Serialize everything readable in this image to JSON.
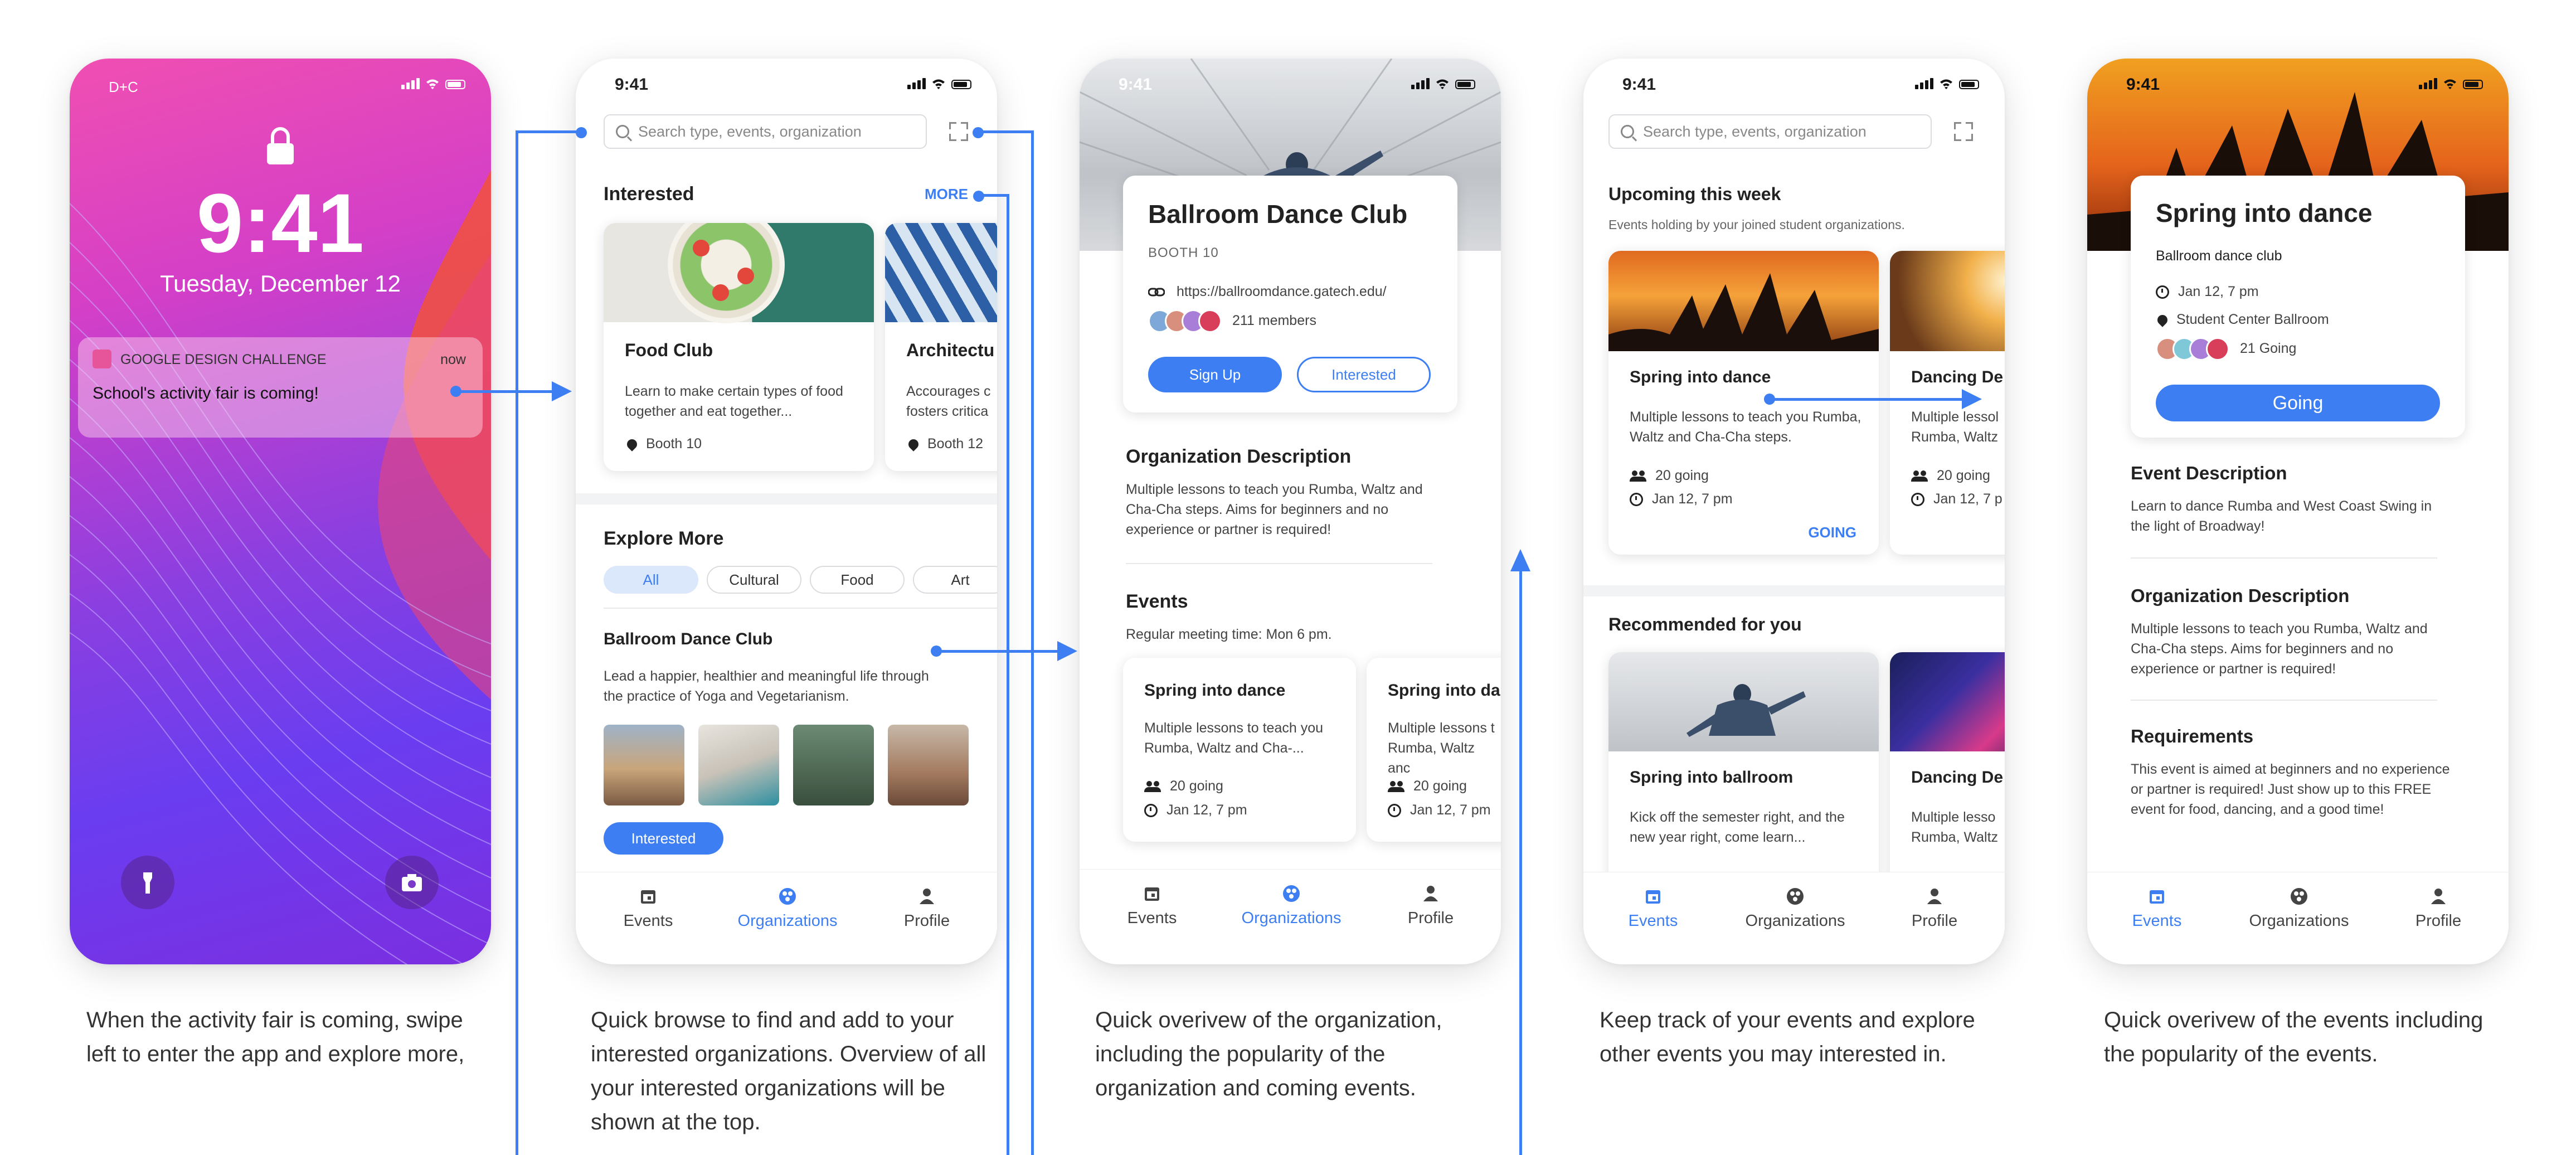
{
  "colors": {
    "accent": "#3d7ff2"
  },
  "phone1": {
    "carrier": "D+C",
    "time": "9:41",
    "date": "Tuesday, December 12",
    "notification": {
      "app": "GOOGLE DESIGN CHALLENGE",
      "when": "now",
      "message": "School's activity fair is coming!"
    },
    "icons": [
      "lock-icon",
      "flashlight-icon",
      "camera-icon"
    ]
  },
  "phone2": {
    "time": "9:41",
    "search_placeholder": "Search type, events, organization",
    "interested_title": "Interested",
    "more_label": "MORE",
    "cards": [
      {
        "title": "Food Club",
        "desc": "Learn to make certain types of food together and eat together...",
        "booth": "Booth 10"
      },
      {
        "title": "Architectu",
        "desc": "Accourages c fosters critica",
        "booth": "Booth 12"
      }
    ],
    "explore_title": "Explore More",
    "chips": [
      "All",
      "Cultural",
      "Food",
      "Art"
    ],
    "club_title": "Ballroom Dance Club",
    "club_desc": "Lead a happier, healthier and meaningful life through the practice of Yoga and Vegetarianism.",
    "interested_btn": "Interested",
    "nav": [
      "Events",
      "Organizations",
      "Profile"
    ]
  },
  "phone3": {
    "time": "9:41",
    "title": "Ballroom Dance Club",
    "booth": "BOOTH 10",
    "url": "https://ballroomdance.gatech.edu/",
    "members": "211 members",
    "signup": "Sign Up",
    "interested": "Interested",
    "org_title": "Organization Description",
    "org_desc": "Multiple lessons to teach you Rumba, Waltz and Cha-Cha steps. Aims for beginners and no experience or partner is required!",
    "events_title": "Events",
    "meeting": "Regular meeting time: Mon 6 pm.",
    "events": [
      {
        "title": "Spring into dance",
        "desc": "Multiple lessons to teach you Rumba, Waltz and Cha-...",
        "going": "20 going",
        "date": "Jan 12, 7 pm"
      },
      {
        "title": "Spring into da",
        "desc": "Multiple lessons t Rumba, Waltz anc",
        "going": "20 going",
        "date": "Jan 12, 7 pm"
      }
    ],
    "nav": [
      "Events",
      "Organizations",
      "Profile"
    ]
  },
  "phone4": {
    "time": "9:41",
    "search_placeholder": "Search type, events, organization",
    "upcoming_title": "Upcoming this week",
    "upcoming_sub": "Events holding by your joined student organizations.",
    "upcoming": [
      {
        "title": "Spring into dance",
        "desc": "Multiple lessons to teach you Rumba, Waltz and Cha-Cha steps.",
        "going": "20 going",
        "date": "Jan 12, 7 pm",
        "status": "GOING"
      },
      {
        "title": "Dancing De",
        "desc": "Multiple lessol Rumba, Waltz",
        "going": "20 going",
        "date": "Jan 12, 7 p"
      }
    ],
    "recommended_title": "Recommended for you",
    "recommended": [
      {
        "title": "Spring into ballroom",
        "desc": "Kick off the semester right, and the new year right, come learn..."
      },
      {
        "title": "Dancing De",
        "desc": "Multiple lesso Rumba, Waltz"
      }
    ],
    "nav": [
      "Events",
      "Organizations",
      "Profile"
    ]
  },
  "phone5": {
    "time": "9:41",
    "title": "Spring into dance",
    "club": "Ballroom dance club",
    "date": "Jan 12, 7 pm",
    "place": "Student Center Ballroom",
    "going_count": "21 Going",
    "going_btn": "Going",
    "event_desc_title": "Event Description",
    "event_desc": "Learn to dance Rumba and West Coast Swing in the light of Broadway!",
    "org_title": "Organization Description",
    "org_desc": "Multiple lessons to teach you Rumba, Waltz and Cha-Cha steps. Aims for beginners and no experience or partner is required!",
    "req_title": "Requirements",
    "req_desc": "This event is aimed at beginners and no experience or partner is required! Just show up to this FREE event for food, dancing, and a good time!",
    "nav": [
      "Events",
      "Organizations",
      "Profile"
    ]
  },
  "captions": [
    "When the activity fair is coming, swipe left to enter the app and explore more,",
    "Quick browse to find and add to your interested organizations. Overview of all your interested organizations will be shown at the top.",
    "Quick overivew of the organization, including the popularity of the organization and coming events.",
    "Keep track of your events and explore other events you may interested in.",
    "Quick overivew of the events including the popularity of the events."
  ]
}
